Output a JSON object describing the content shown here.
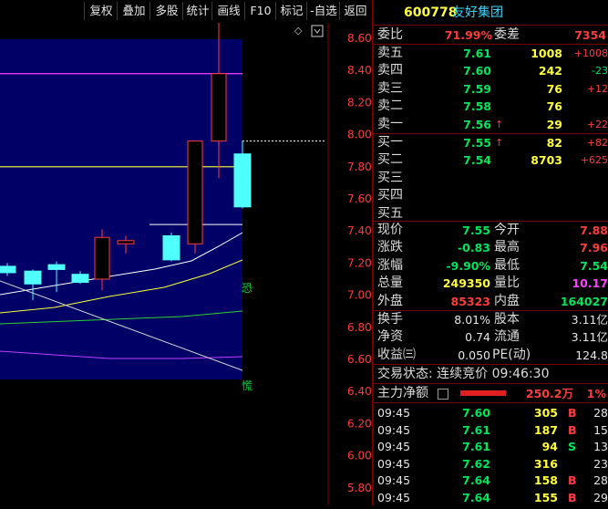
{
  "toolbar": {
    "buttons": [
      "复权",
      "叠加",
      "多股",
      "统计",
      "画线",
      "F10",
      "标记",
      "-自选",
      "返回"
    ]
  },
  "chart_data": {
    "type": "candlestick",
    "ylim": [
      5.9,
      8.75
    ],
    "y_ticks": [
      "8.60",
      "8.40",
      "8.20",
      "8.00",
      "7.80",
      "7.60",
      "7.40",
      "7.20",
      "7.00",
      "6.80",
      "6.60",
      "6.40",
      "6.20",
      "6.00",
      "5.80"
    ],
    "candles": [
      {
        "open": 7.18,
        "close": 7.14,
        "high": 7.2,
        "low": 7.12
      },
      {
        "open": 7.15,
        "close": 7.07,
        "high": 7.16,
        "low": 6.97
      },
      {
        "open": 7.19,
        "close": 7.16,
        "high": 7.21,
        "low": 7.02
      },
      {
        "open": 7.13,
        "close": 7.08,
        "high": 7.15,
        "low": 7.07
      },
      {
        "open": 7.1,
        "close": 7.36,
        "high": 7.41,
        "low": 7.03
      },
      {
        "open": 7.32,
        "close": 7.34,
        "high": 7.37,
        "low": 7.26
      },
      {
        "open": 7.37,
        "close": 7.22,
        "high": 7.39,
        "low": 7.21
      },
      {
        "open": 7.32,
        "close": 7.96,
        "high": 7.96,
        "low": 7.26
      },
      {
        "open": 7.96,
        "close": 8.38,
        "high": 8.71,
        "low": 7.73
      },
      {
        "open": 7.88,
        "close": 7.55,
        "high": 7.96,
        "low": 7.54
      }
    ],
    "levels": {
      "yellow": 7.8,
      "magenta": 8.38,
      "limit_up_dotted": 7.96,
      "white": 7.44
    },
    "markers": [
      "恐",
      "慌"
    ]
  },
  "quote": {
    "code": "600778",
    "name": "友好集团",
    "weibi_label": "委比",
    "weibi": "71.99%",
    "weicha_label": "委差",
    "weicha": "7354",
    "sells": [
      {
        "label": "卖五",
        "price": "7.61",
        "vol": "1008",
        "chg": "+1008"
      },
      {
        "label": "卖四",
        "price": "7.60",
        "vol": "242",
        "chg": "-23"
      },
      {
        "label": "卖三",
        "price": "7.59",
        "vol": "76",
        "chg": "+12"
      },
      {
        "label": "卖二",
        "price": "7.58",
        "vol": "76",
        "chg": ""
      },
      {
        "label": "卖一",
        "price": "7.56",
        "vol": "29",
        "chg": "+22"
      }
    ],
    "buys": [
      {
        "label": "买一",
        "price": "7.55",
        "vol": "82",
        "chg": "+82"
      },
      {
        "label": "买二",
        "price": "7.54",
        "vol": "8703",
        "chg": "+625"
      },
      {
        "label": "买三",
        "price": "",
        "vol": "",
        "chg": ""
      },
      {
        "label": "买四",
        "price": "",
        "vol": "",
        "chg": ""
      },
      {
        "label": "买五",
        "price": "",
        "vol": "",
        "chg": ""
      }
    ],
    "stats1": [
      {
        "l1": "现价",
        "v1": "7.55",
        "l2": "今开",
        "v2": "7.88"
      },
      {
        "l1": "涨跌",
        "v1": "-0.83",
        "l2": "最高",
        "v2": "7.96"
      },
      {
        "l1": "涨幅",
        "v1": "-9.90%",
        "l2": "最低",
        "v2": "7.54"
      },
      {
        "l1": "总量",
        "v1": "249350",
        "l2": "量比",
        "v2": "10.17"
      },
      {
        "l1": "外盘",
        "v1": "85323",
        "l2": "内盘",
        "v2": "164027"
      }
    ],
    "stats2": [
      {
        "l1": "换手",
        "v1": "8.01%",
        "l2": "股本",
        "v2": "3.11亿"
      },
      {
        "l1": "净资",
        "v1": "0.74",
        "l2": "流通",
        "v2": "3.11亿"
      },
      {
        "l1": "收益㈢",
        "v1": "0.050",
        "l2": "PE(动)",
        "v2": "124.8"
      }
    ],
    "trade_status": "交易状态: 连续竞价 09:46:30",
    "main_flow_label": "主力净额",
    "main_flow_value": "250.2万",
    "main_flow_pct": "1%",
    "ticks": [
      {
        "time": "09:45",
        "price": "7.60",
        "vol": "305",
        "side": "B",
        "num": "28"
      },
      {
        "time": "09:45",
        "price": "7.61",
        "vol": "187",
        "side": "B",
        "num": "15"
      },
      {
        "time": "09:45",
        "price": "7.61",
        "vol": "94",
        "side": "S",
        "num": "13"
      },
      {
        "time": "09:45",
        "price": "7.62",
        "vol": "316",
        "side": "",
        "num": "23"
      },
      {
        "time": "09:45",
        "price": "7.64",
        "vol": "158",
        "side": "B",
        "num": "28"
      },
      {
        "time": "09:45",
        "price": "7.64",
        "vol": "155",
        "side": "B",
        "num": "29"
      }
    ]
  }
}
